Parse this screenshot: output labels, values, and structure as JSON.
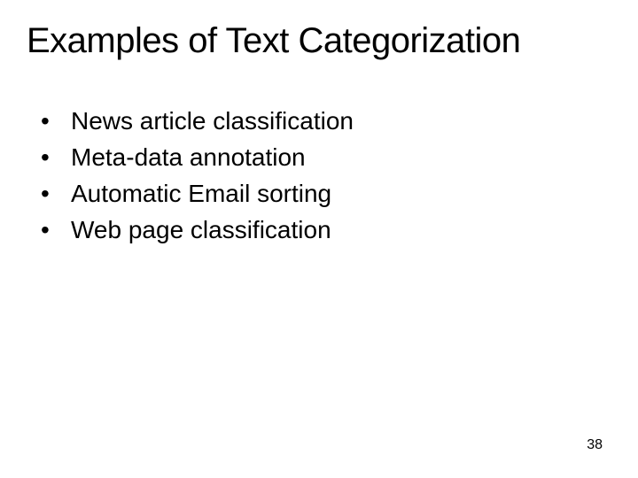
{
  "slide": {
    "title": "Examples of Text Categorization",
    "bullets": [
      "News article classification",
      "Meta-data annotation",
      "Automatic Email sorting",
      "Web page classification"
    ],
    "page_number": "38"
  }
}
